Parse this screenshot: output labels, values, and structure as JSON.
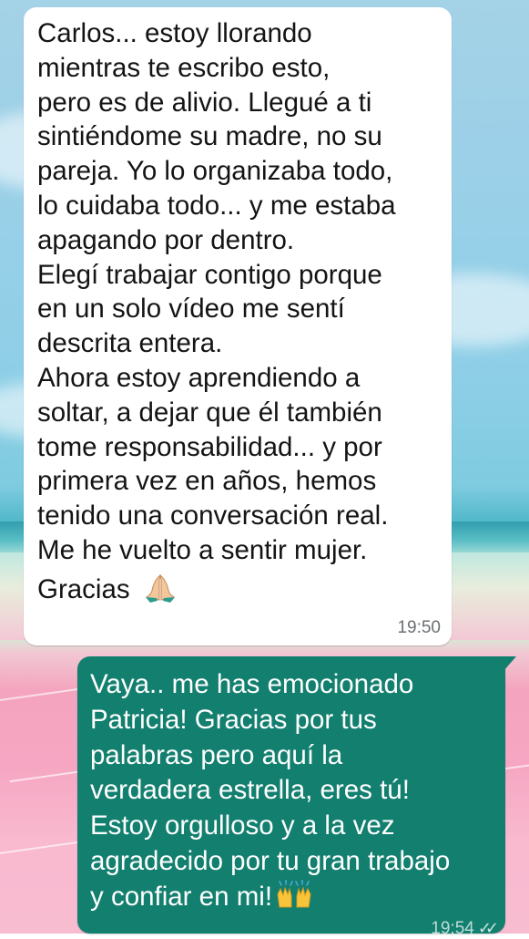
{
  "conversation": {
    "incoming": {
      "text": "Carlos... estoy llorando\nmientras te escribo esto,\npero es de alivio. Llegué a ti\nsintiéndome su madre, no su\npareja. Yo lo organizaba todo,\nlo cuidaba todo... y me estaba\napagando por dentro.\nElegí trabajar contigo porque\nen un solo vídeo me sentí\ndescrita entera.\nAhora estoy aprendiendo a\nsoltar, a dejar que él también\ntome responsabilidad... y por\nprimera vez en años, hemos\ntenido una conversación real.\nMe he vuelto a sentir mujer.",
      "closing": "Gracias",
      "emoji_icon": "folded-hands-icon",
      "time": "19:50"
    },
    "outgoing": {
      "text": "Vaya.. me has emocionado\nPatricia! Gracias por tus\npalabras pero aquí la\nverdadera estrella, eres tú!\nEstoy orgulloso y a la vez\nagradecido por tu gran trabajo\ny confiar en mi!",
      "emoji_icon": "raising-hands-icon",
      "time": "19:54",
      "status_icon": "double-check-icon"
    }
  },
  "colors": {
    "incoming_bubble": "#ffffff",
    "outgoing_bubble": "#127f6f",
    "timestamp_gray": "#6b6f72"
  }
}
